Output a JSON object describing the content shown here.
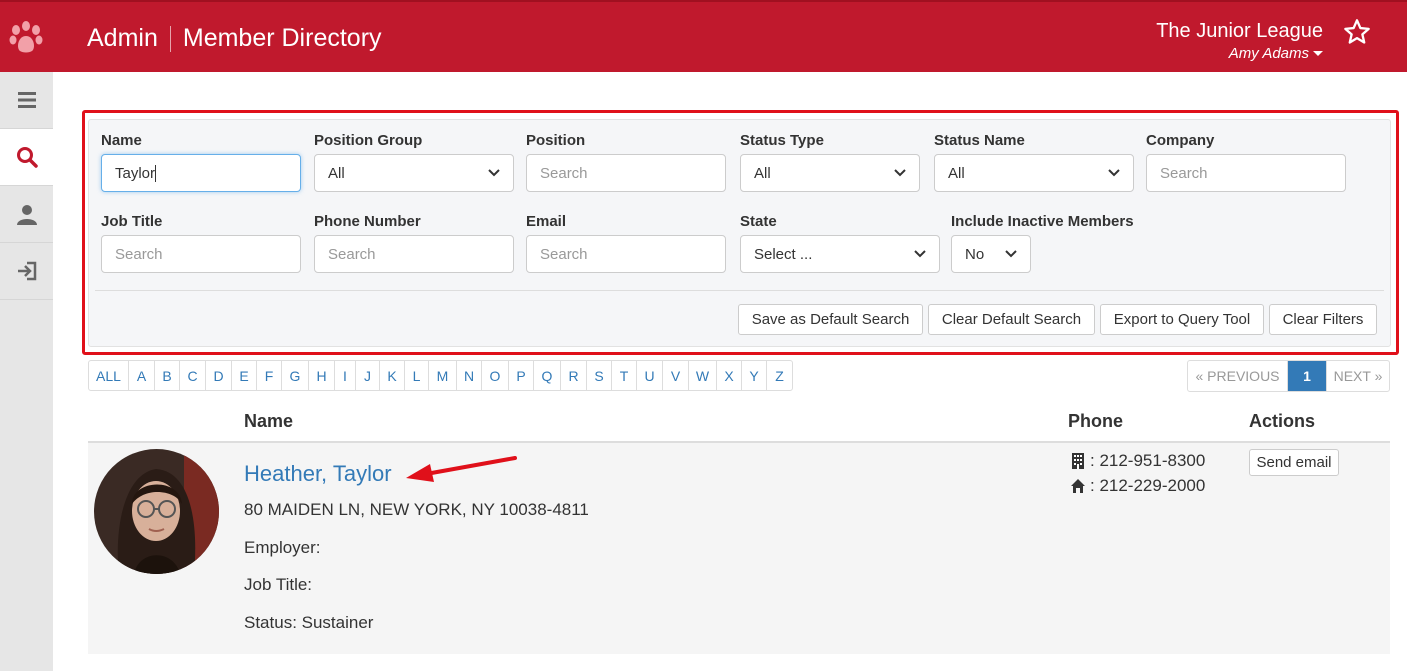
{
  "header": {
    "section": "Admin",
    "title": "Member Directory",
    "org_name": "The Junior League",
    "user_name": "Amy Adams"
  },
  "colors": {
    "brand": "#c0192d",
    "link": "#337ab7",
    "highlight": "#e0101a"
  },
  "sidebar": {
    "items": [
      {
        "icon": "menu-icon"
      },
      {
        "icon": "search-icon",
        "active": true
      },
      {
        "icon": "person-icon"
      },
      {
        "icon": "sign-in-icon"
      }
    ]
  },
  "filters": {
    "name": {
      "label": "Name",
      "value": "Taylor"
    },
    "position_group": {
      "label": "Position Group",
      "value": "All"
    },
    "position": {
      "label": "Position",
      "placeholder": "Search"
    },
    "status_type": {
      "label": "Status Type",
      "value": "All"
    },
    "status_name": {
      "label": "Status Name",
      "value": "All"
    },
    "company": {
      "label": "Company",
      "placeholder": "Search"
    },
    "job_title": {
      "label": "Job Title",
      "placeholder": "Search"
    },
    "phone": {
      "label": "Phone Number",
      "placeholder": "Search"
    },
    "email": {
      "label": "Email",
      "placeholder": "Search"
    },
    "state": {
      "label": "State",
      "value": "Select ..."
    },
    "inactive": {
      "label": "Include Inactive Members",
      "value": "No"
    },
    "buttons": {
      "save_default": "Save as Default Search",
      "clear_default": "Clear Default Search",
      "export": "Export to Query Tool",
      "clear_filters": "Clear Filters"
    }
  },
  "alphabet": [
    "ALL",
    "A",
    "B",
    "C",
    "D",
    "E",
    "F",
    "G",
    "H",
    "I",
    "J",
    "K",
    "L",
    "M",
    "N",
    "O",
    "P",
    "Q",
    "R",
    "S",
    "T",
    "U",
    "V",
    "W",
    "X",
    "Y",
    "Z"
  ],
  "pagination": {
    "previous": "« PREVIOUS",
    "current": "1",
    "next": "NEXT »"
  },
  "table": {
    "headers": {
      "name": "Name",
      "phone": "Phone",
      "actions": "Actions"
    },
    "rows": [
      {
        "name": "Heather, Taylor",
        "address": "80 MAIDEN LN, NEW YORK, NY 10038-4811",
        "employer": "Employer:",
        "job_title": "Job Title:",
        "status": "Status: Sustainer",
        "work_phone": ": 212-951-8300",
        "home_phone": ": 212-229-2000",
        "action": "Send email"
      }
    ]
  }
}
